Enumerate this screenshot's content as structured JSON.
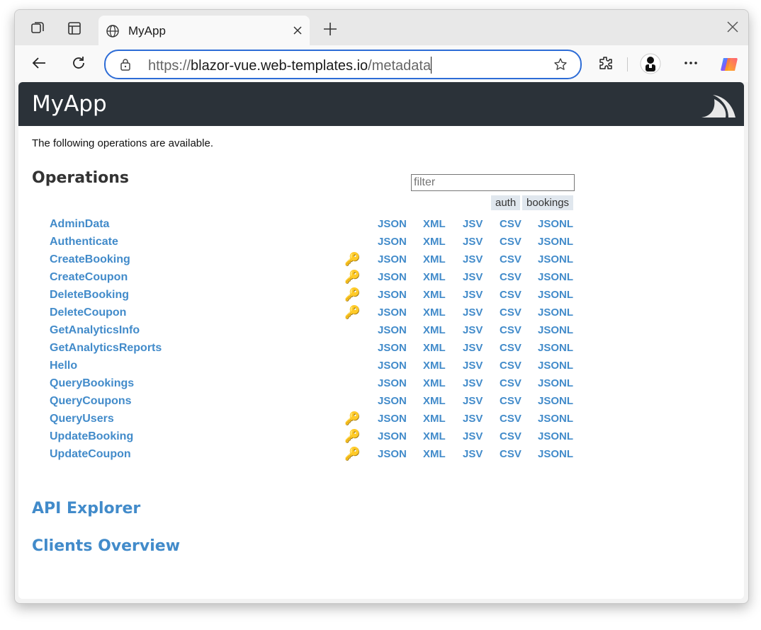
{
  "browser": {
    "tab_title": "MyApp",
    "url_prefix": "https://",
    "url_host": "blazor-vue.web-templates.io",
    "url_path": "/metadata"
  },
  "page": {
    "brand": "MyApp",
    "intro": "The following operations are available.",
    "operations_title": "Operations",
    "filter_placeholder": "filter",
    "tags": [
      "auth",
      "bookings"
    ],
    "formats": [
      "JSON",
      "XML",
      "JSV",
      "CSV",
      "JSONL"
    ],
    "operations": [
      {
        "name": "AdminData",
        "requires_auth": false
      },
      {
        "name": "Authenticate",
        "requires_auth": false
      },
      {
        "name": "CreateBooking",
        "requires_auth": true
      },
      {
        "name": "CreateCoupon",
        "requires_auth": true
      },
      {
        "name": "DeleteBooking",
        "requires_auth": true
      },
      {
        "name": "DeleteCoupon",
        "requires_auth": true
      },
      {
        "name": "GetAnalyticsInfo",
        "requires_auth": false
      },
      {
        "name": "GetAnalyticsReports",
        "requires_auth": false
      },
      {
        "name": "Hello",
        "requires_auth": false
      },
      {
        "name": "QueryBookings",
        "requires_auth": false
      },
      {
        "name": "QueryCoupons",
        "requires_auth": false
      },
      {
        "name": "QueryUsers",
        "requires_auth": true
      },
      {
        "name": "UpdateBooking",
        "requires_auth": true
      },
      {
        "name": "UpdateCoupon",
        "requires_auth": true
      }
    ],
    "api_explorer": "API Explorer",
    "clients_overview": "Clients Overview"
  },
  "colors": {
    "link": "#428bca",
    "header_bg": "#2b3239",
    "address_focus": "#2d6cd6"
  }
}
